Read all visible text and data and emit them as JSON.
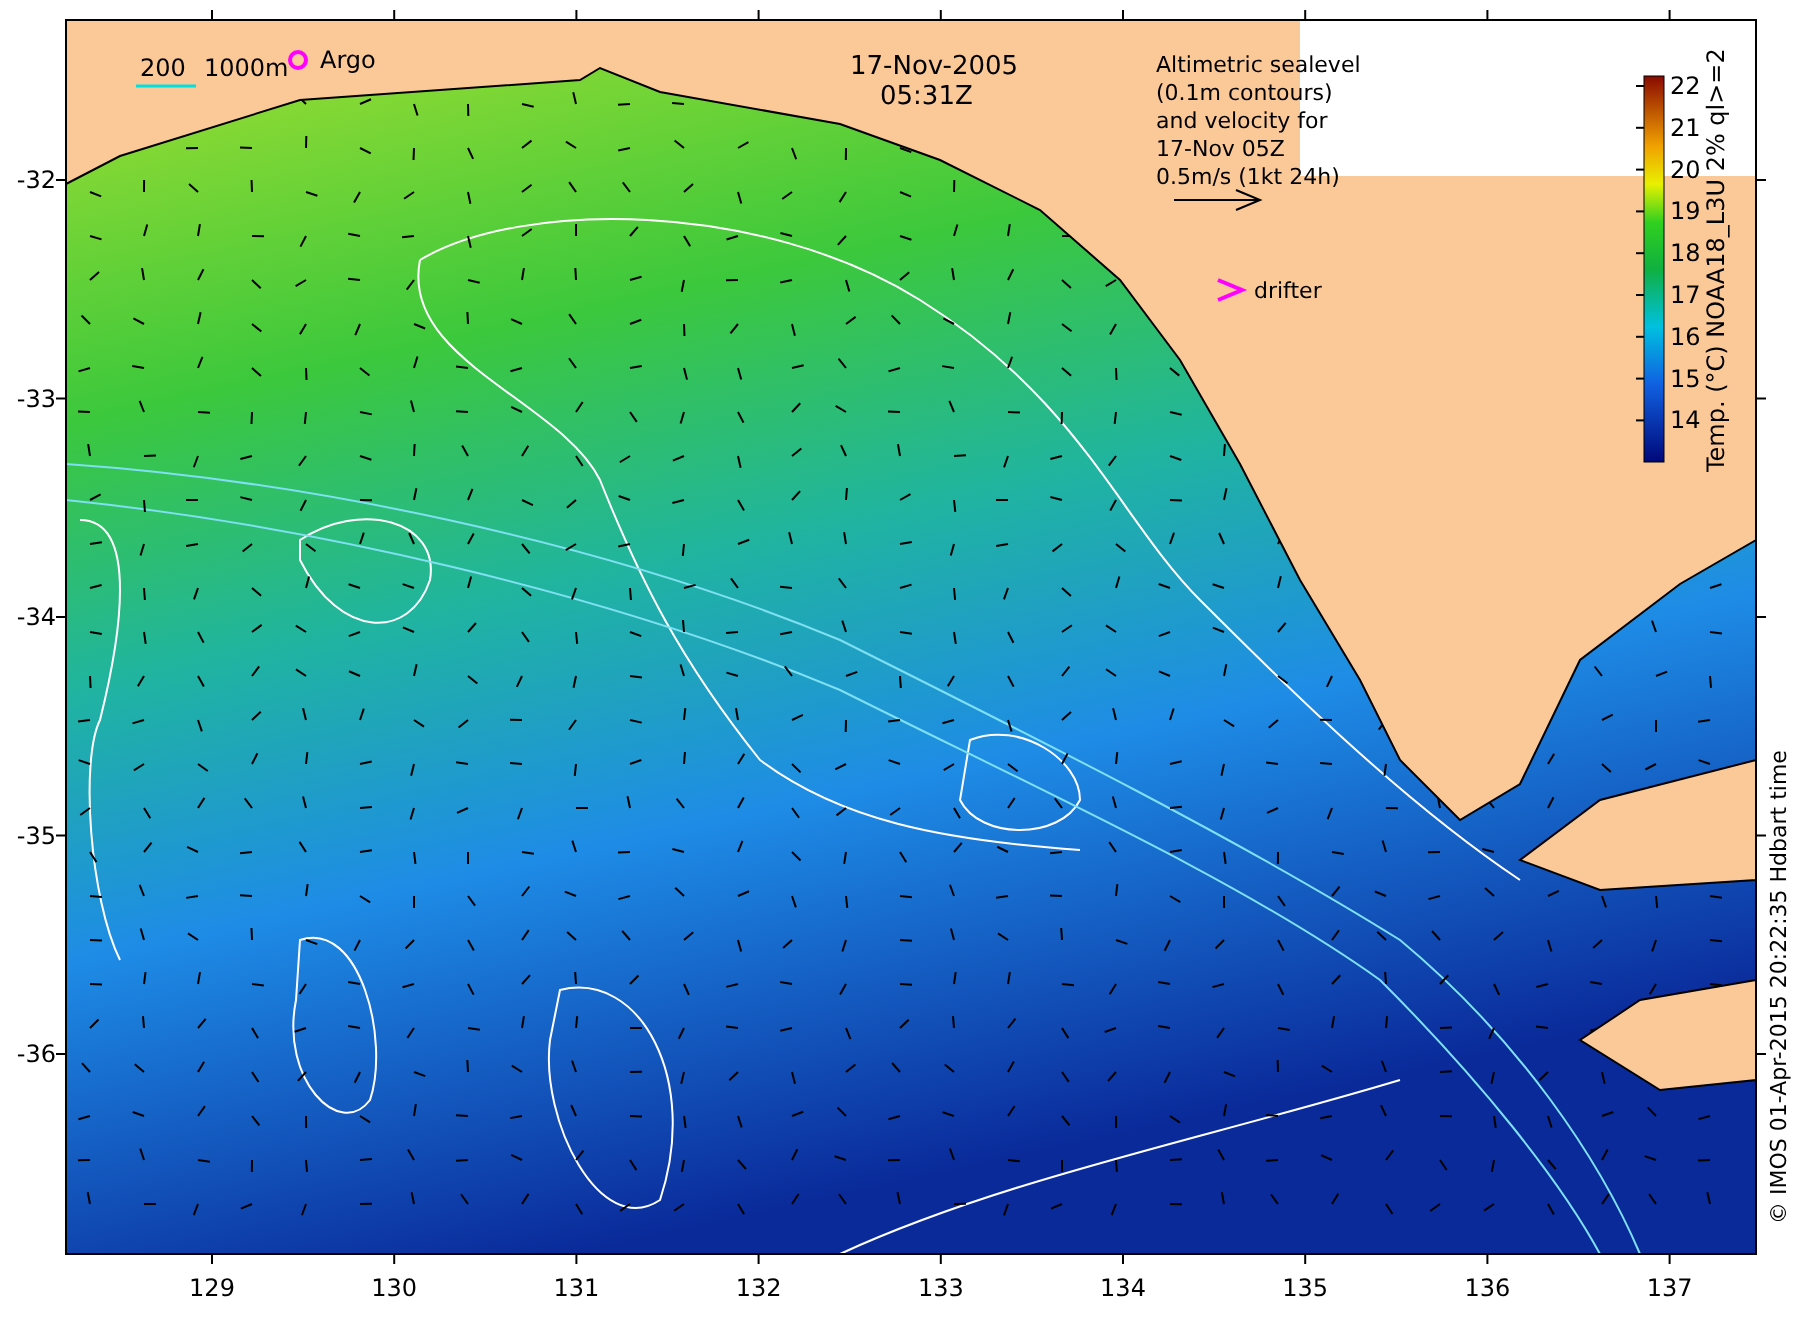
{
  "title": {
    "date": "17-Nov-2005",
    "time": "05:31Z"
  },
  "bathymetry_legend": [
    "200",
    "1000m"
  ],
  "argo_legend": {
    "label": "Argo"
  },
  "altimetry_note": [
    "Altimetric sealevel",
    "(0.1m contours)",
    "and velocity for",
    "17-Nov 05Z",
    "0.5m/s (1kt 24h)"
  ],
  "drifter_legend": {
    "label": "drifter"
  },
  "colorbar": {
    "title": "Temp. (°C) NOAA18_L3U 2% ql>=2",
    "ticks": [
      "22",
      "21",
      "20",
      "19",
      "18",
      "17",
      "16",
      "15",
      "14"
    ]
  },
  "x_axis": {
    "ticks": [
      "129",
      "130",
      "131",
      "132",
      "133",
      "134",
      "135",
      "136",
      "137"
    ]
  },
  "y_axis": {
    "ticks": [
      "-32",
      "-33",
      "-34",
      "-35",
      "-36"
    ]
  },
  "credit": "© IMOS 01-Apr-2015 20:22:35 Hdbart time"
}
